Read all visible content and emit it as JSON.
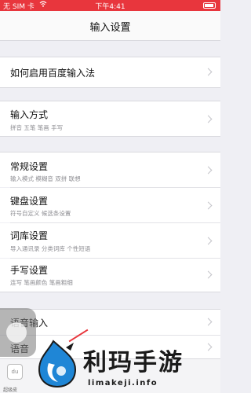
{
  "status_bar": {
    "carrier": "无 SIM 卡",
    "time": "下午4:41"
  },
  "nav": {
    "title": "输入设置"
  },
  "sections": {
    "how_to_enable": {
      "label": "如何启用百度输入法"
    },
    "input_method": {
      "label": "输入方式",
      "sub": "拼音 五笔 笔画 手写"
    },
    "general": {
      "label": "常规设置",
      "sub": "输入模式 模糊音 双拼 联想"
    },
    "keyboard": {
      "label": "键盘设置",
      "sub": "符号自定义 候选条设置"
    },
    "lexicon": {
      "label": "词库设置",
      "sub": "导入通讯录 分类词库 个性短语"
    },
    "handwriting": {
      "label": "手写设置",
      "sub": "连写 笔画颜色 笔画粗细"
    },
    "voice_input": {
      "label": "语音输入"
    },
    "voice_partial": {
      "label": "语音"
    }
  },
  "bottom_bar": {
    "app_icon_text": "du",
    "app_label": "超级皮"
  },
  "watermark": {
    "title": "利玛手游",
    "url": "limakeji.info"
  },
  "colors": {
    "status_bar": "#e8363d",
    "background": "#efeff4",
    "row": "#ffffff"
  }
}
